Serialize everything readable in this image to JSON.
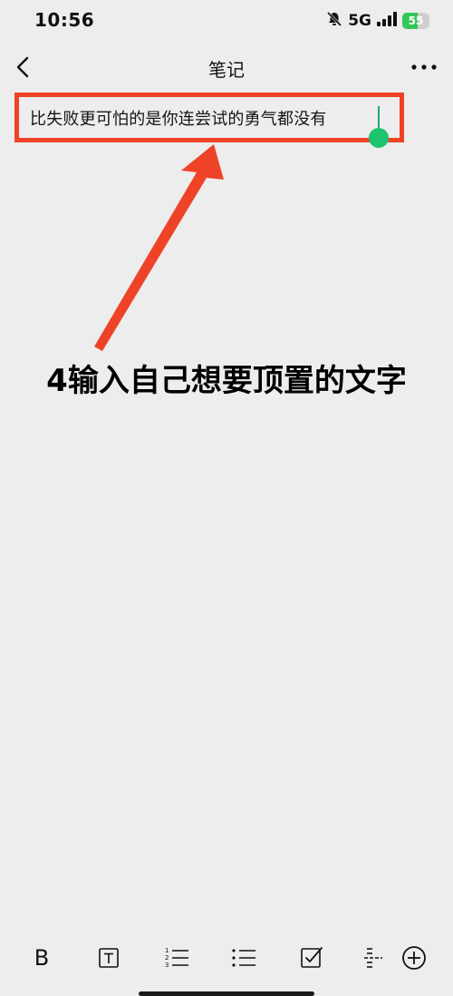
{
  "status_bar": {
    "time": "10:56",
    "network": "5G",
    "battery_level": "55",
    "battery_fraction": 0.55,
    "accent_color": "#34c759"
  },
  "navbar": {
    "title": "笔记",
    "back_icon": "chevron-left-icon",
    "more_icon": "more-dots-icon"
  },
  "editor": {
    "text": "比失败更可怕的是你连尝试的勇气都没有",
    "highlight_color": "#ee4327",
    "caret_color": "#1aad6f"
  },
  "annotation": {
    "text": "4输入自己想要顶置的文字",
    "arrow_color": "#ee4327"
  },
  "toolbar": {
    "bold_label": "B",
    "items": [
      "bold-icon",
      "text-style-icon",
      "numbered-list-icon",
      "bulleted-list-icon",
      "checkbox-icon",
      "divider-icon",
      "add-icon"
    ]
  }
}
